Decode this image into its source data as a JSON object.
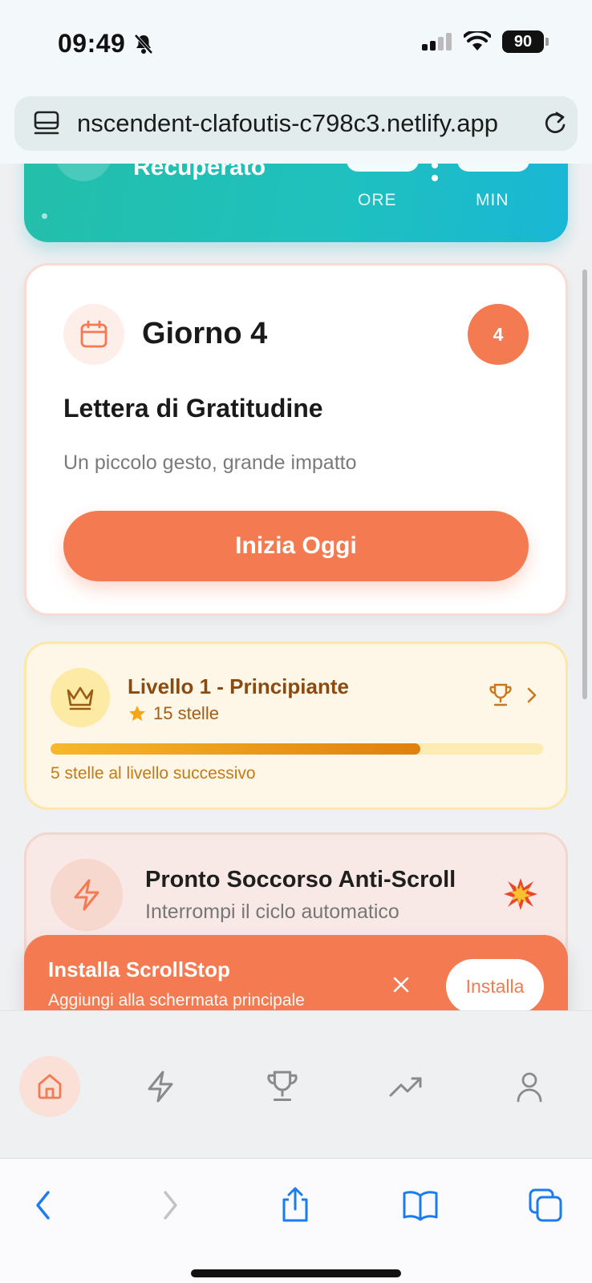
{
  "status_bar": {
    "time": "09:49",
    "battery": "90"
  },
  "browser": {
    "url": "nscendent-clafoutis-c798c3.netlify.app"
  },
  "hero": {
    "label": "Recuperato",
    "unit_hours": "ORE",
    "unit_minutes": "MIN"
  },
  "day_card": {
    "title": "Giorno 4",
    "badge": "4",
    "heading": "Lettera di Gratitudine",
    "subtitle": "Un piccolo gesto, grande impatto",
    "button": "Inizia Oggi"
  },
  "level_card": {
    "title": "Livello 1 - Principiante",
    "stars": "15 stelle",
    "progress": 0.75,
    "note": "5 stelle al livello successivo"
  },
  "sos_card": {
    "title": "Pronto Soccorso Anti-Scroll",
    "subtitle": "Interrompi il ciclo automatico",
    "emoji": "💥"
  },
  "install_banner": {
    "title": "Installa ScrollStop",
    "subtitle": "Aggiungi alla schermata principale",
    "button": "Installa"
  },
  "app_nav": {
    "items": [
      {
        "icon": "home-icon",
        "active": true
      },
      {
        "icon": "lightning-icon",
        "active": false
      },
      {
        "icon": "trophy-icon",
        "active": false
      },
      {
        "icon": "trending-up-icon",
        "active": false
      },
      {
        "icon": "user-icon",
        "active": false
      }
    ]
  },
  "colors": {
    "accent": "#f47a52",
    "teal": "#1fc0bf",
    "gold": "#e0800e",
    "ios_blue": "#1a7cf0"
  }
}
